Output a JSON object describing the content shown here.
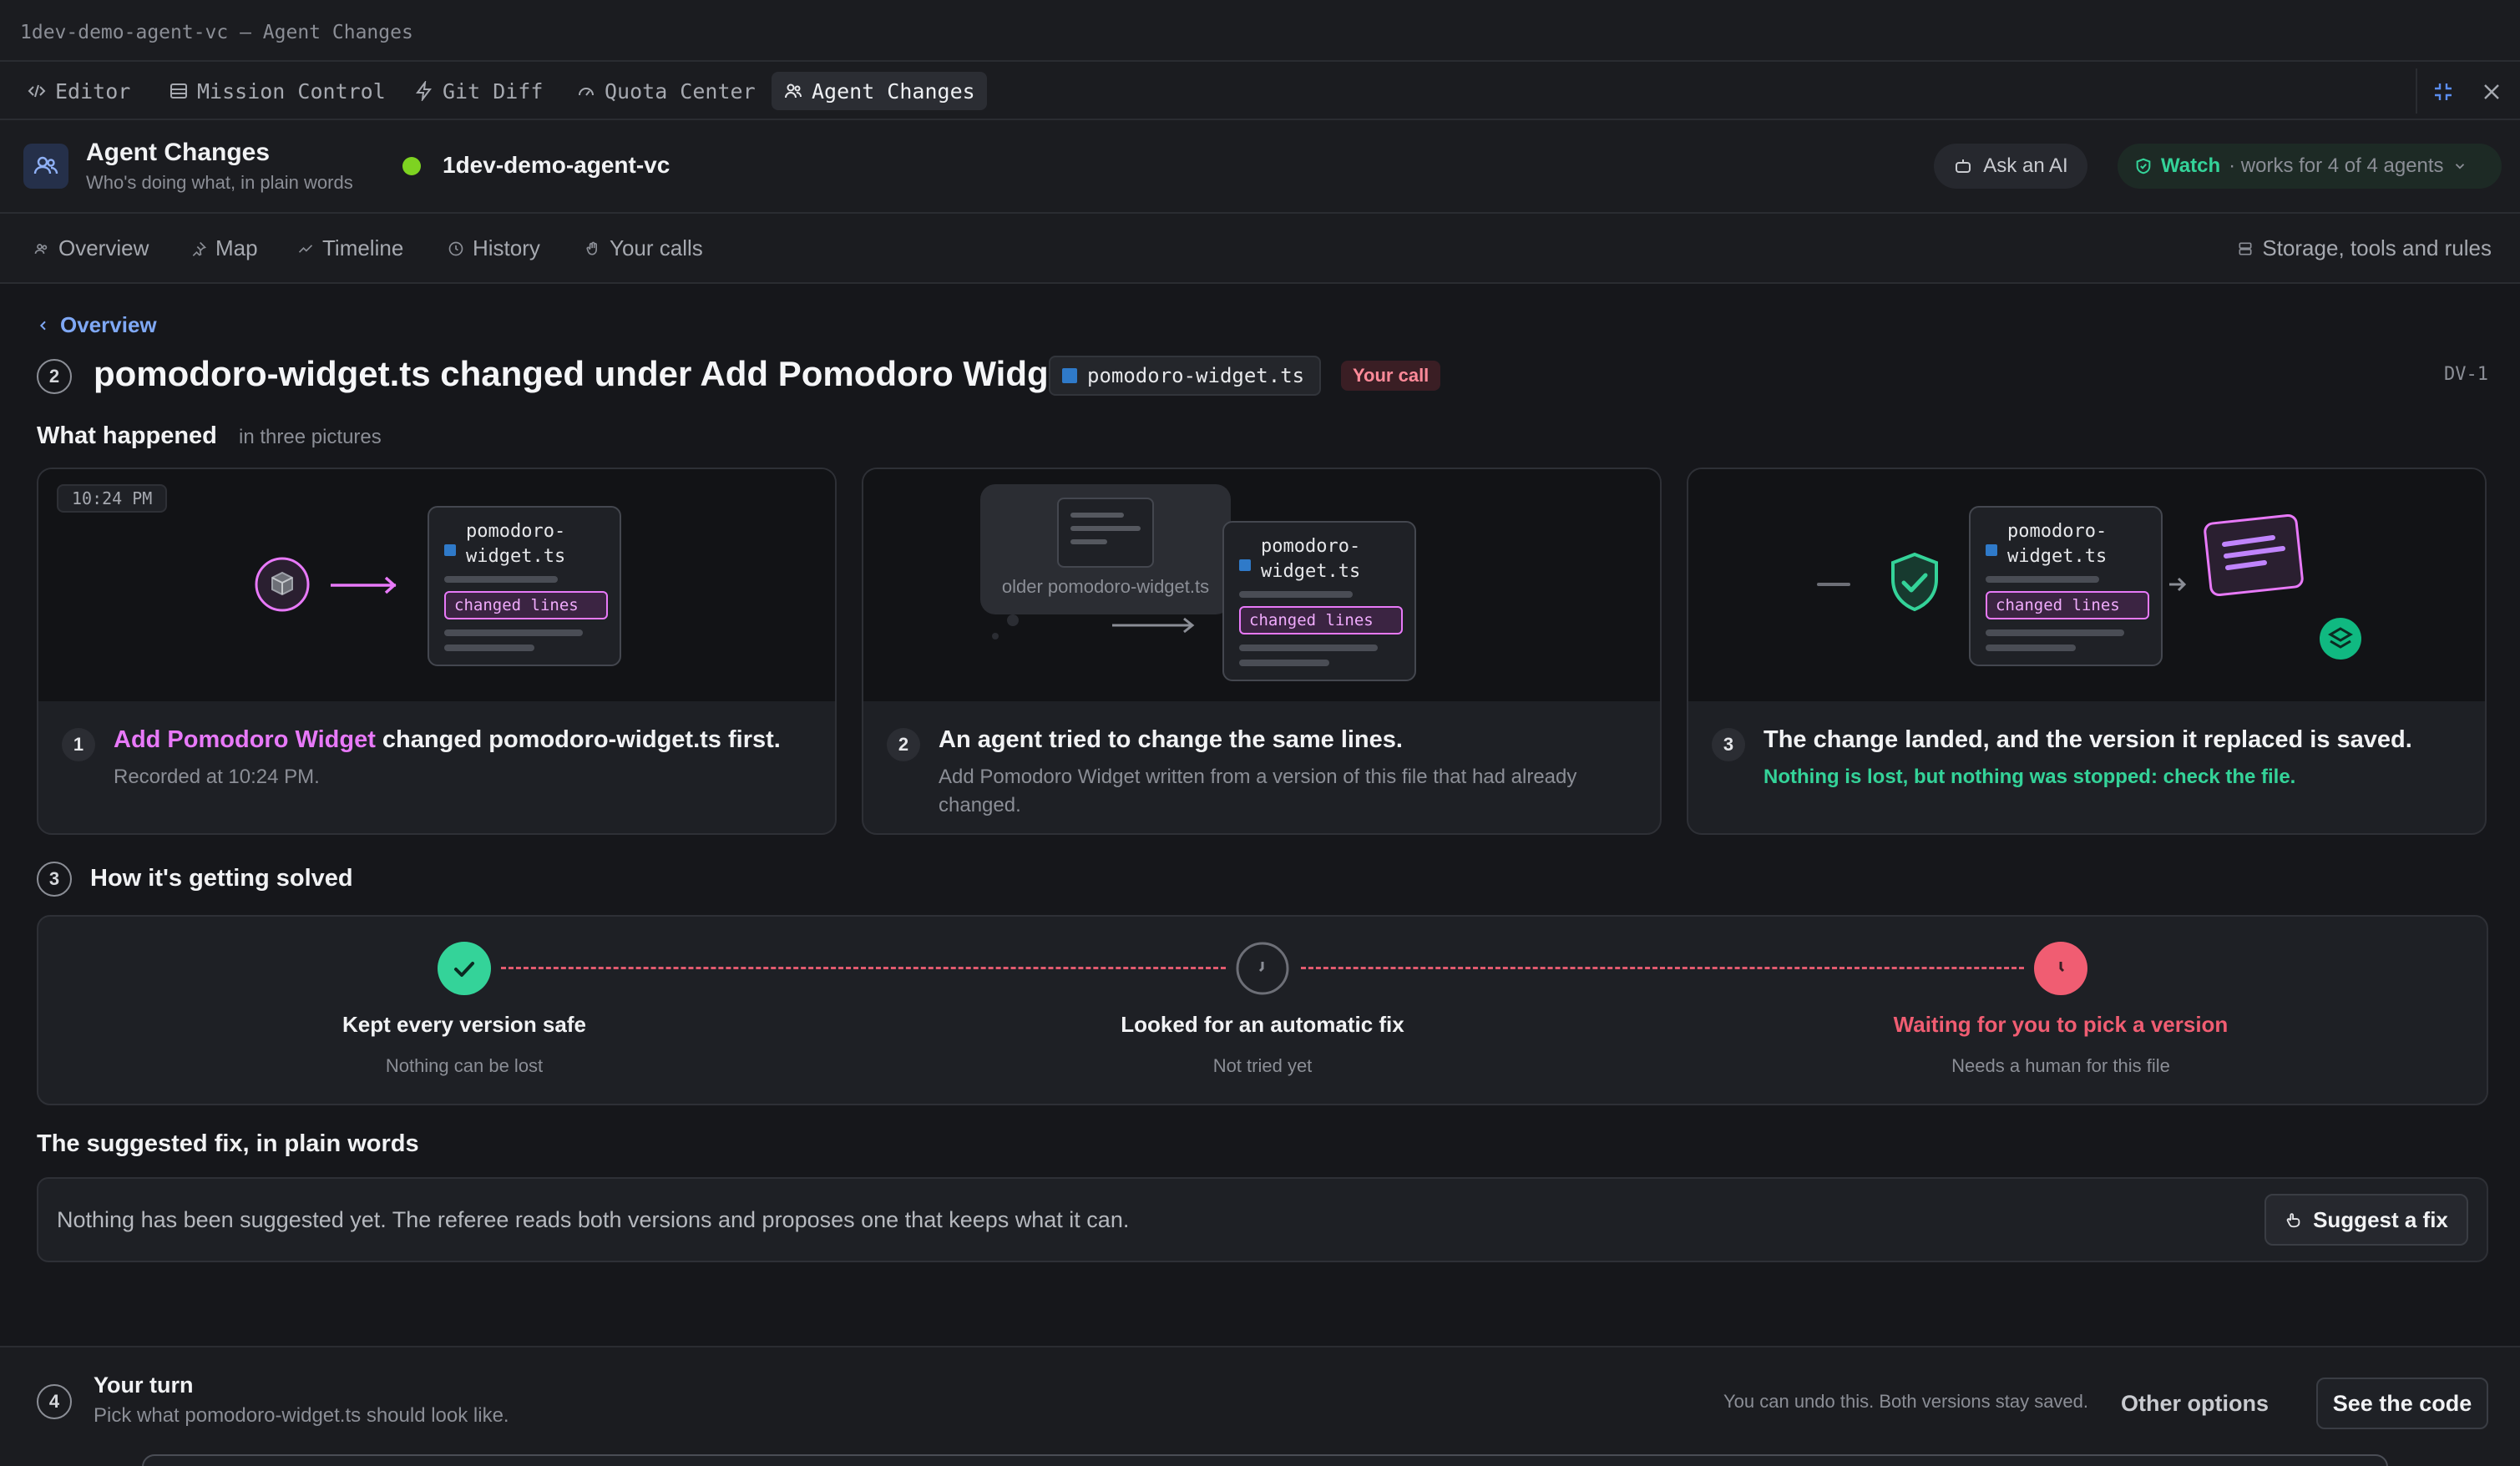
{
  "window": {
    "title": "1dev-demo-agent-vc — Agent Changes"
  },
  "top_tabs": [
    {
      "label": "Editor",
      "icon": "code-icon"
    },
    {
      "label": "Mission Control",
      "icon": "panel-icon"
    },
    {
      "label": "Git Diff",
      "icon": "bolt-icon"
    },
    {
      "label": "Quota Center",
      "icon": "gauge-icon"
    },
    {
      "label": "Agent Changes",
      "icon": "users-icon",
      "active": true
    }
  ],
  "header": {
    "title": "Agent Changes",
    "subtitle": "Who's doing what, in plain words",
    "project": "1dev-demo-agent-vc",
    "project_status_color": "#7ed321",
    "ask_ai": "Ask an AI",
    "watch_label": "Watch",
    "watch_suffix": "· works for 4 of 4 agents"
  },
  "sub_nav": {
    "tabs": [
      "Overview",
      "Map",
      "Timeline",
      "History",
      "Your calls"
    ],
    "right": "Storage, tools and rules"
  },
  "breadcrumb": {
    "back": "Overview"
  },
  "issue": {
    "number": "2",
    "title": "pomodoro-widget.ts changed under Add Pomodoro Widget",
    "file": "pomodoro-widget.ts",
    "badge": "Your call",
    "id": "DV-1"
  },
  "what_happened": {
    "heading": "What happened",
    "sub": "in three pictures",
    "time_pill": "10:24 PM",
    "file_line1": "pomodoro-",
    "file_line2": "widget.ts",
    "changed_lines": "changed lines",
    "older_label": "older pomodoro-widget.ts",
    "cards": [
      {
        "num": "1",
        "title_highlight": "Add Pomodoro Widget",
        "title_rest": " changed pomodoro-widget.ts first.",
        "desc": "Recorded at 10:24 PM."
      },
      {
        "num": "2",
        "title": "An agent tried to change the same lines.",
        "desc": "Add Pomodoro Widget written from a version of this file that had already changed."
      },
      {
        "num": "3",
        "title": "The change landed, and the version it replaced is saved.",
        "desc": "Nothing is lost, but nothing was stopped: check the file."
      }
    ]
  },
  "solving": {
    "number": "3",
    "heading": "How it's getting solved",
    "steps": [
      {
        "title": "Kept every version safe",
        "sub": "Nothing can be lost",
        "state": "done"
      },
      {
        "title": "Looked for an automatic fix",
        "sub": "Not tried yet",
        "state": "pending"
      },
      {
        "title": "Waiting for you to pick a version",
        "sub": "Needs a human for this file",
        "state": "waiting"
      }
    ]
  },
  "suggested_fix": {
    "heading": "The suggested fix, in plain words",
    "text": "Nothing has been suggested yet. The referee reads both versions and proposes one that keeps what it can.",
    "button": "Suggest a fix"
  },
  "your_turn": {
    "number": "4",
    "title": "Your turn",
    "sub": "Pick what pomodoro-widget.ts should look like.",
    "note": "You can undo this. Both versions stay saved.",
    "other": "Other options",
    "see_code": "See the code"
  },
  "colors": {
    "accent_green": "#34d399",
    "accent_pink": "#e879f9",
    "accent_red": "#f05d72",
    "link_blue": "#7fa8f5"
  }
}
